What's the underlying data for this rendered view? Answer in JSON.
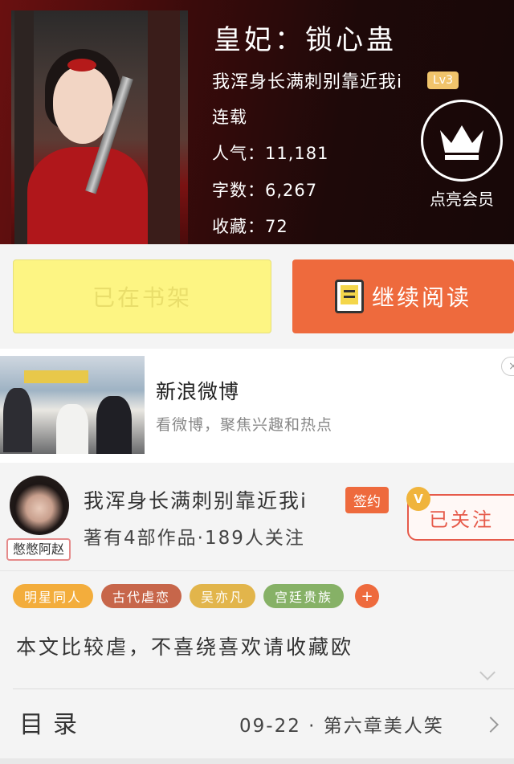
{
  "book": {
    "title": "皇妃：锁心蛊",
    "author": "我浑身长满刺别靠近我i",
    "author_level": "Lv3",
    "status": "连载",
    "popularity_label": "人气：",
    "popularity": "11,181",
    "word_count_label": "字数：",
    "word_count": "6,267",
    "favorites_label": "收藏：",
    "favorites": "72"
  },
  "vip": {
    "icon": "crown-icon",
    "label": "点亮会员"
  },
  "actions": {
    "shelf_label": "已在书架",
    "read_label": "继续阅读",
    "read_icon": "book-icon"
  },
  "ad": {
    "title": "新浪微博",
    "subtitle": "看微博，聚焦兴趣和热点",
    "close_icon": "close-icon"
  },
  "author_card": {
    "avatar_name": "憋憋阿赵",
    "name": "我浑身长满刺别靠近我i",
    "signed_label": "签约",
    "verified_badge": "V",
    "works_summary": "著有4部作品·189人关注",
    "follow_label": "已关注"
  },
  "tags": [
    {
      "label": "明星同人",
      "color": "#f3ad3c"
    },
    {
      "label": "古代虐恋",
      "color": "#c7664a"
    },
    {
      "label": "吴亦凡",
      "color": "#e2b54b"
    },
    {
      "label": "宫廷贵族",
      "color": "#86b166"
    }
  ],
  "tag_more": "+",
  "description": "本文比较虐，不喜绕喜欢请收藏欧",
  "toc": {
    "label": "目录",
    "latest": "09-22 · 第六章美人笑"
  },
  "colors": {
    "accent": "#ee6a3d",
    "shelf_bg": "#fdf583",
    "header_dark": "#1e0909"
  }
}
